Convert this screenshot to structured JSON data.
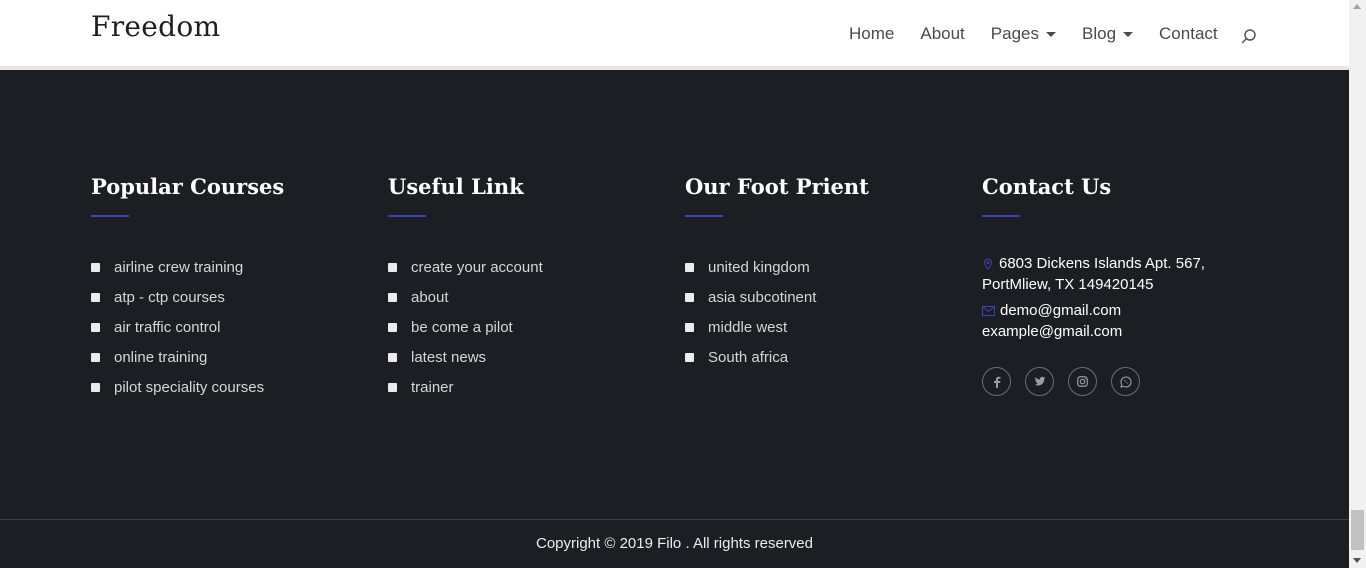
{
  "header": {
    "logo": "Freedom",
    "nav": [
      {
        "label": "Home",
        "dropdown": false
      },
      {
        "label": "About",
        "dropdown": false
      },
      {
        "label": "Pages",
        "dropdown": true
      },
      {
        "label": "Blog",
        "dropdown": true
      },
      {
        "label": "Contact",
        "dropdown": false
      }
    ],
    "search_icon": "search-icon"
  },
  "footer": {
    "columns": [
      {
        "title": "Popular Courses",
        "items": [
          "airline crew training",
          "atp - ctp courses",
          "air traffic control",
          "online training",
          "pilot speciality courses"
        ]
      },
      {
        "title": "Useful Link",
        "items": [
          "create your account",
          "about",
          "be come a pilot",
          "latest news",
          "trainer"
        ]
      },
      {
        "title": "Our Foot Prient",
        "items": [
          "united kingdom",
          "asia subcotinent",
          "middle west",
          "South africa"
        ]
      }
    ],
    "contact": {
      "title": "Contact Us",
      "address_line1": "6803 Dickens Islands Apt. 567,",
      "address_line2": "PortMliew, TX 149420145",
      "email1": "demo@gmail.com",
      "email2": "example@gmail.com",
      "socials": [
        "facebook-icon",
        "twitter-icon",
        "instagram-icon",
        "whatsapp-icon"
      ]
    },
    "copyright": "Copyright © 2019 Filo . All rights reserved"
  },
  "colors": {
    "footer_bg": "#1b1e23",
    "accent_underline": "#3f3fb6",
    "header_bg": "#ffffff"
  }
}
